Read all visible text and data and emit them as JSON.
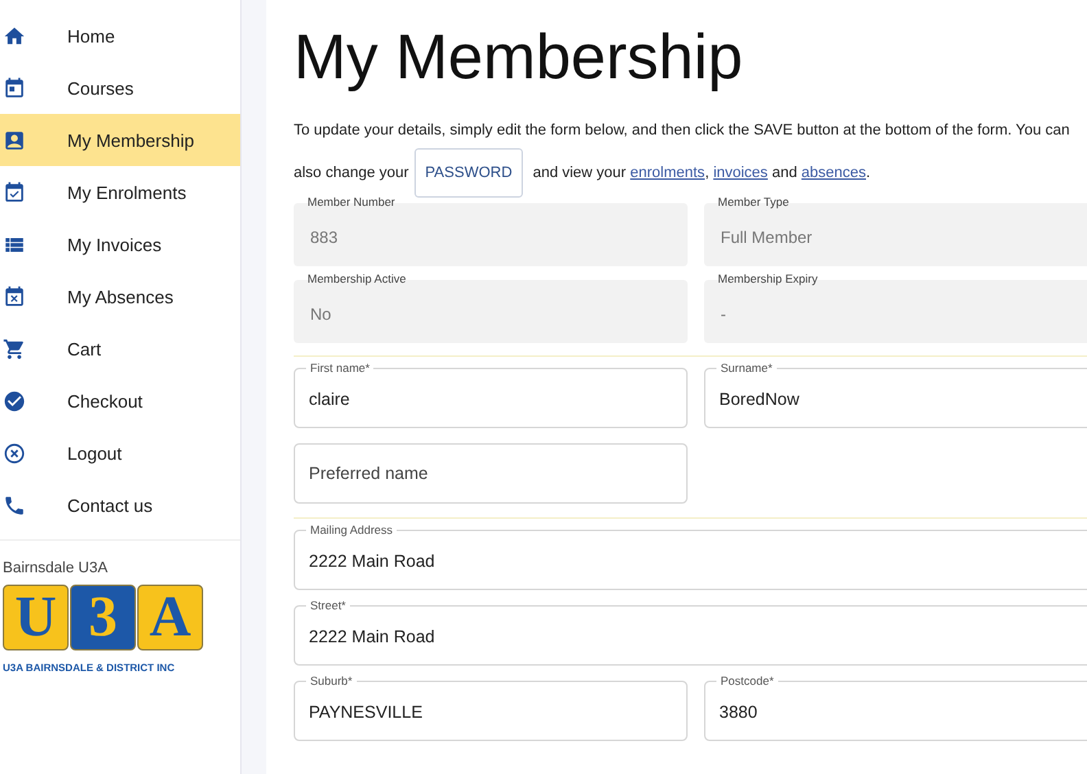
{
  "sidebar": {
    "items": [
      {
        "label": "Home",
        "selected": false
      },
      {
        "label": "Courses",
        "selected": false
      },
      {
        "label": "My Membership",
        "selected": true
      },
      {
        "label": "My Enrolments",
        "selected": false
      },
      {
        "label": "My Invoices",
        "selected": false
      },
      {
        "label": "My Absences",
        "selected": false
      },
      {
        "label": "Cart",
        "selected": false
      },
      {
        "label": "Checkout",
        "selected": false
      },
      {
        "label": "Logout",
        "selected": false
      },
      {
        "label": "Contact us",
        "selected": false
      }
    ],
    "org_name": "Bairnsdale U3A",
    "logo": {
      "letters": [
        "U",
        "3",
        "A"
      ],
      "tagline": "U3A BAIRNSDALE & DISTRICT INC"
    }
  },
  "page": {
    "title": "My Membership",
    "intro": [
      {
        "kind": "text",
        "text": "To update your details, simply edit the form below, and then click the SAVE button at the bottom of the form. You can also change your"
      },
      {
        "kind": "button",
        "text": "PASSWORD"
      },
      {
        "kind": "text",
        "text": "and view your"
      },
      {
        "kind": "link",
        "text": "enrolments"
      },
      {
        "kind": "text",
        "text": ","
      },
      {
        "kind": "link",
        "text": "invoices"
      },
      {
        "kind": "text",
        "text": "and"
      },
      {
        "kind": "link",
        "text": "absences"
      },
      {
        "kind": "text",
        "text": "."
      }
    ],
    "sections": [
      {
        "fields": [
          {
            "kind": "readonly",
            "label": "Member Number",
            "value": "883"
          },
          {
            "kind": "readonly",
            "label": "Member Type",
            "value": "Full Member"
          },
          {
            "kind": "readonly",
            "label": "Membership Active",
            "value": "No"
          },
          {
            "kind": "readonly",
            "label": "Membership Expiry",
            "value": "-"
          }
        ]
      },
      {
        "fields": [
          {
            "kind": "outlined",
            "label": "First name*",
            "value": "claire"
          },
          {
            "kind": "outlined",
            "label": "Surname*",
            "value": "BoredNow"
          },
          {
            "kind": "empty",
            "placeholder": "Preferred name"
          }
        ]
      },
      {
        "fields": [
          {
            "kind": "outlined_wide",
            "label": "Mailing Address",
            "value": "2222 Main Road"
          },
          {
            "kind": "outlined_wide",
            "label": "Street*",
            "value": "2222 Main Road"
          },
          {
            "kind": "outlined",
            "label": "Suburb*",
            "value": "PAYNESVILLE"
          },
          {
            "kind": "outlined",
            "label": "Postcode*",
            "value": "3880"
          }
        ]
      }
    ]
  }
}
